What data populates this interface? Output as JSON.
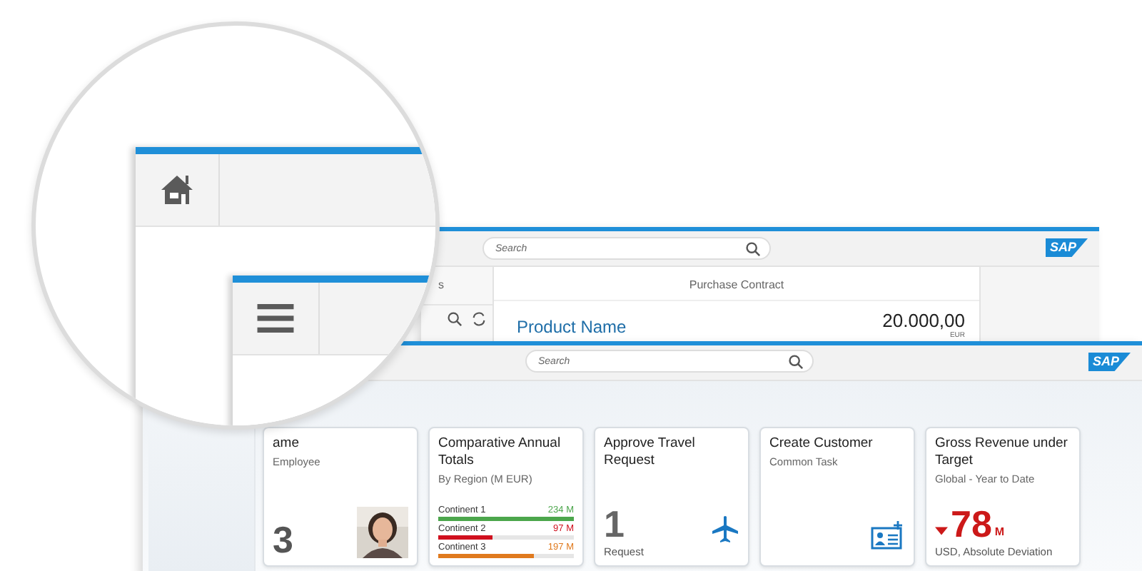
{
  "back_window": {
    "search": {
      "placeholder": "Search"
    },
    "logo": "SAP",
    "list_header": "s",
    "detail": {
      "header": "Purchase Contract",
      "product": "Product Name",
      "amount": "20.000,00",
      "currency": "EUR"
    }
  },
  "front_window": {
    "search": {
      "placeholder": "Search"
    },
    "logo": "SAP",
    "tiles": [
      {
        "kind": "person",
        "title": "ame",
        "subtitle": "Employee",
        "number": "3"
      },
      {
        "kind": "comparison",
        "title": "Comparative Annual Totals",
        "subtitle": "By Region (M EUR)",
        "rows": [
          {
            "label": "Continent 1",
            "value": "234 M",
            "level": 1,
            "color": "#4ca64c"
          },
          {
            "label": "Continent 2",
            "value": "97 M",
            "level": 0.4,
            "color": "#d0101e"
          },
          {
            "label": "Continent 3",
            "value": "197 M",
            "level": 0.7,
            "color": "#e07a1e"
          }
        ]
      },
      {
        "kind": "launch",
        "title": "Approve Travel Request",
        "number": "1",
        "unit": "Request"
      },
      {
        "kind": "action",
        "title": "Create Customer",
        "subtitle": "Common Task"
      },
      {
        "kind": "kpi",
        "title": "Gross Revenue under Target",
        "subtitle": "Global - Year to Date",
        "number": "78",
        "scale": "M",
        "declining": true,
        "footer": "USD, Absolute Deviation"
      }
    ]
  }
}
